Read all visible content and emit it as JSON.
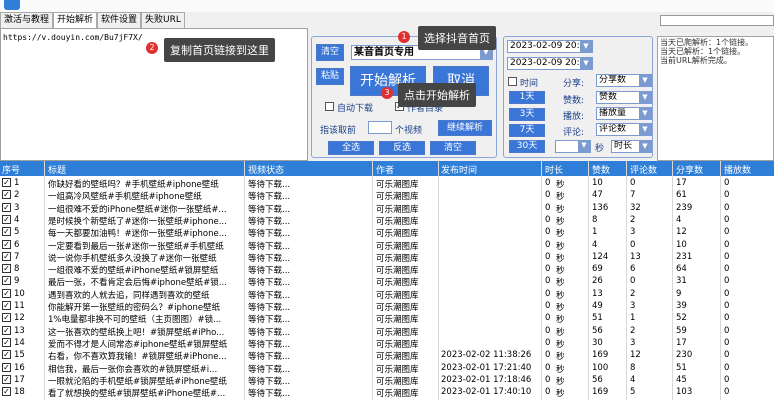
{
  "tabs": [
    "激活与教程",
    "开始解析",
    "软件设置",
    "失败URL"
  ],
  "url_text": "https://v.douyin.com/Bu7jF7X/",
  "tips": {
    "t1": "选择抖音首页",
    "t2": "复制首页链接到这里",
    "t3": "点击开始解析"
  },
  "badges": {
    "b1": "1",
    "b2": "2",
    "b3": "3"
  },
  "controls": {
    "clear_btn": "清空",
    "paste_btn": "粘贴",
    "source_select": "某音首页专用",
    "start_btn": "开始解析",
    "cancel_btn": "取消",
    "auto_download": "自动下载",
    "author_dir": "作者目录",
    "pre_fetch_label": "指该取前",
    "pre_fetch_unit": "个视频",
    "continue_btn": "继续解析",
    "select_all_btn": "全选",
    "invert_btn": "反选",
    "clear2_btn": "清空",
    "date_start": "2023-02-09 20:32:43",
    "date_end": "2023-02-09 20:32:43",
    "time_label": "时间",
    "day1": "1天",
    "day2": "2天",
    "day3": "3天",
    "day7": "7天",
    "day30": "30天",
    "seconds_label": "秒",
    "share_label": "分享:",
    "share_val": "分享数",
    "like_label": "赞数:",
    "like_val": "赞数",
    "play_label": "播放:",
    "play_val": "播放量",
    "comment_label": "评论:",
    "comment_val": "评论数",
    "time_sort_val": "时长"
  },
  "log": [
    "当天已爬解析：1个链接。",
    "当天已解析：1个链接。",
    "当前URL解析完成。"
  ],
  "table": {
    "headers": [
      "序号",
      "标题",
      "视频状态",
      "作者",
      "发布时间",
      "时长",
      "赞数",
      "评论数",
      "分享数",
      "播放数"
    ],
    "rows": [
      [
        "1",
        "你缺好看的壁纸吗？#手机壁纸#iphone壁纸",
        "等待下载...",
        "可乐潮图库",
        "",
        "0",
        "秒",
        "10",
        "0",
        "17",
        "0"
      ],
      [
        "2",
        "一组高冷风壁纸#手机壁纸#iphone壁纸",
        "等待下载...",
        "可乐潮图库",
        "",
        "0",
        "秒",
        "47",
        "7",
        "61",
        "0"
      ],
      [
        "3",
        "一组很难不爱的iPhone壁纸#迷你一张壁纸#...",
        "等待下载...",
        "可乐潮图库",
        "",
        "0",
        "秒",
        "136",
        "32",
        "239",
        "0"
      ],
      [
        "4",
        "是时候换个新壁纸了#迷你一张壁纸#iphone...",
        "等待下载...",
        "可乐潮图库",
        "",
        "0",
        "秒",
        "8",
        "2",
        "4",
        "0"
      ],
      [
        "5",
        "每一天都要加油鸭！#迷你一张壁纸#iphone...",
        "等待下载...",
        "可乐潮图库",
        "",
        "0",
        "秒",
        "1",
        "3",
        "12",
        "0"
      ],
      [
        "6",
        "一定要看到最后一张#迷你一张壁纸#手机壁纸",
        "等待下载...",
        "可乐潮图库",
        "",
        "0",
        "秒",
        "4",
        "0",
        "10",
        "0"
      ],
      [
        "7",
        "说一说你手机壁纸多久没换了#迷你一张壁纸",
        "等待下载...",
        "可乐潮图库",
        "",
        "0",
        "秒",
        "124",
        "13",
        "231",
        "0"
      ],
      [
        "8",
        "一组很难不爱的壁纸#iPhone壁纸#锁屏壁纸",
        "等待下载...",
        "可乐潮图库",
        "",
        "0",
        "秒",
        "69",
        "6",
        "64",
        "0"
      ],
      [
        "9",
        "最后一张，不看肯定会后悔#iphone壁纸#锁...",
        "等待下载...",
        "可乐潮图库",
        "",
        "0",
        "秒",
        "26",
        "0",
        "31",
        "0"
      ],
      [
        "10",
        "遇到喜欢的人就去追，同样遇到喜欢的壁纸",
        "等待下载...",
        "可乐潮图库",
        "",
        "0",
        "秒",
        "13",
        "2",
        "9",
        "0"
      ],
      [
        "11",
        "你能解开第一张壁纸的密码么？#iphone壁纸",
        "等待下载...",
        "可乐潮图库",
        "",
        "0",
        "秒",
        "49",
        "3",
        "39",
        "0"
      ],
      [
        "12",
        "1%电量都非换不可的壁纸（主页图图）#锁...",
        "等待下载...",
        "可乐潮图库",
        "",
        "0",
        "秒",
        "51",
        "1",
        "52",
        "0"
      ],
      [
        "13",
        "这一张喜欢的壁纸换上吧！#锁屏壁纸#iPho...",
        "等待下载...",
        "可乐潮图库",
        "",
        "0",
        "秒",
        "56",
        "2",
        "59",
        "0"
      ],
      [
        "14",
        "爱而不得才是人间常态#iphone壁纸#锁屏壁纸",
        "等待下载...",
        "可乐潮图库",
        "",
        "0",
        "秒",
        "30",
        "3",
        "17",
        "0"
      ],
      [
        "15",
        "右看，你不喜欢算我输！#锁屏壁纸#iPhone...",
        "等待下载...",
        "可乐潮图库",
        "2023-02-02 11:38:26",
        "0",
        "秒",
        "169",
        "12",
        "230",
        "0"
      ],
      [
        "16",
        "相信我，最后一张你会喜欢的#锁屏壁纸#i...",
        "等待下载...",
        "可乐潮图库",
        "2023-02-01 17:21:40",
        "0",
        "秒",
        "100",
        "8",
        "51",
        "0"
      ],
      [
        "17",
        "一眼就沦陷的手机壁纸#锁屏壁纸#iPhone壁纸",
        "等待下载...",
        "可乐潮图库",
        "2023-02-01 17:18:46",
        "0",
        "秒",
        "56",
        "4",
        "45",
        "0"
      ],
      [
        "18",
        "看了就想换的壁纸#锁屏壁纸#iPhone壁纸#...",
        "等待下载...",
        "可乐潮图库",
        "2023-02-01 17:40:10",
        "0",
        "秒",
        "169",
        "5",
        "103",
        "0"
      ]
    ]
  },
  "colors": {
    "accent": "#2f7fd8",
    "button_text": "#1a3f8a",
    "tip_bg": "#454545",
    "badge": "#e03030"
  }
}
